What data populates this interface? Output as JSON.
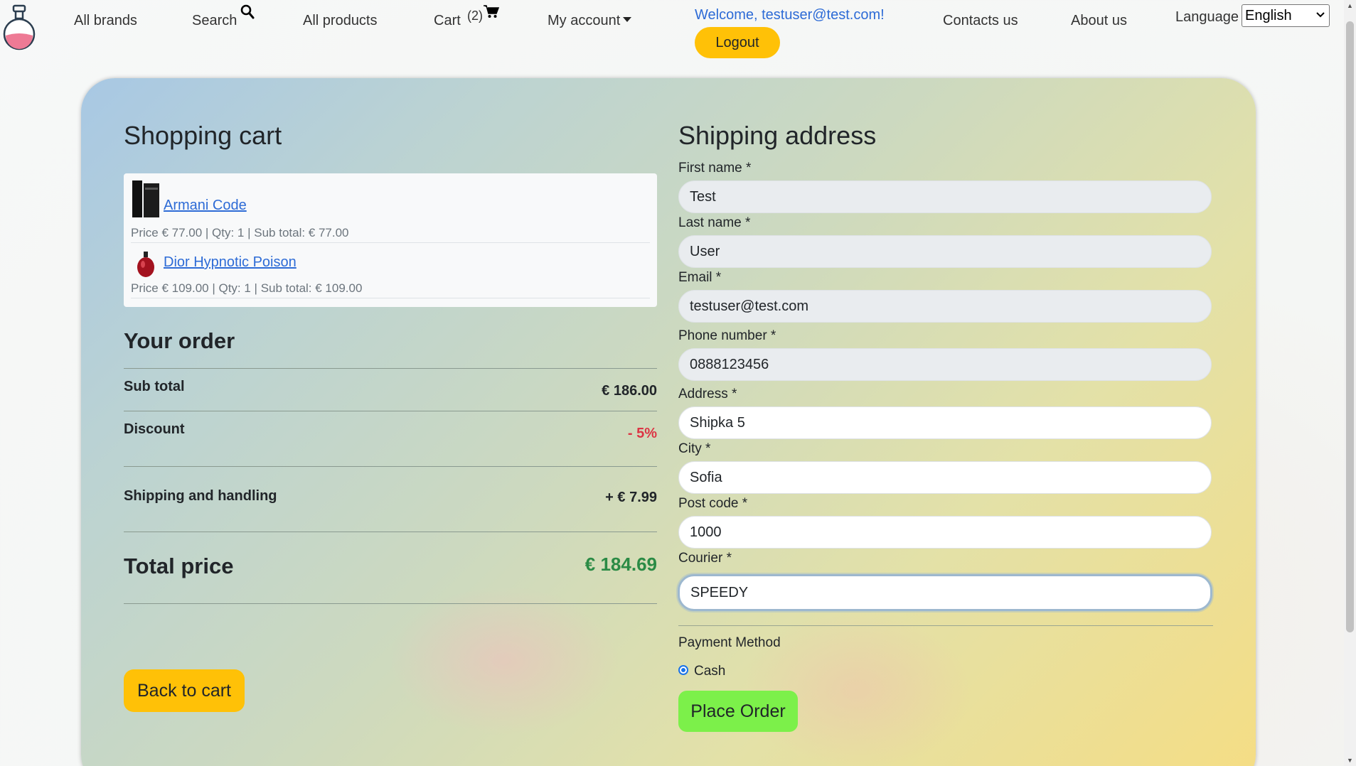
{
  "nav": {
    "all_brands": "All brands",
    "search": "Search",
    "all_products": "All products",
    "cart": "Cart",
    "cart_count": "(2)",
    "my_account": "My account",
    "welcome": "Welcome, testuser@test.com!",
    "logout": "Logout",
    "contacts": "Contacts us",
    "about": "About us",
    "language_label": "Language",
    "language_value": "English"
  },
  "cart": {
    "title": "Shopping cart",
    "items": [
      {
        "name": "Armani Code",
        "meta": "Price € 77.00 | Qty: 1 | Sub total: € 77.00"
      },
      {
        "name": "Dior Hypnotic Poison",
        "meta": "Price € 109.00 | Qty: 1 | Sub total: € 109.00"
      }
    ]
  },
  "order": {
    "title": "Your order",
    "subtotal_label": "Sub total",
    "subtotal_value": "€ 186.00",
    "discount_label": "Discount",
    "discount_value": "- 5%",
    "shipping_label": "Shipping and handling",
    "shipping_value": "+ € 7.99",
    "total_label": "Total price",
    "total_value": "€ 184.69",
    "back_button": "Back to cart"
  },
  "shipping": {
    "title": "Shipping address",
    "first_name_label": "First name *",
    "first_name": "Test",
    "last_name_label": "Last name *",
    "last_name": "User",
    "email_label": "Email *",
    "email": "testuser@test.com",
    "phone_label": "Phone number *",
    "phone": "0888123456",
    "address_label": "Address *",
    "address": "Shipka 5",
    "city_label": "City *",
    "city": "Sofia",
    "post_code_label": "Post code *",
    "post_code": "1000",
    "courier_label": "Courier *",
    "courier": "SPEEDY",
    "payment_label": "Payment Method",
    "payment_option": "Cash",
    "place_order": "Place Order"
  },
  "colors": {
    "accent_yellow": "#ffc107",
    "place_order_green": "#7cf04a",
    "link_blue": "#2d6bd6",
    "total_green": "#2b8b45",
    "discount_red": "#dc3545"
  }
}
